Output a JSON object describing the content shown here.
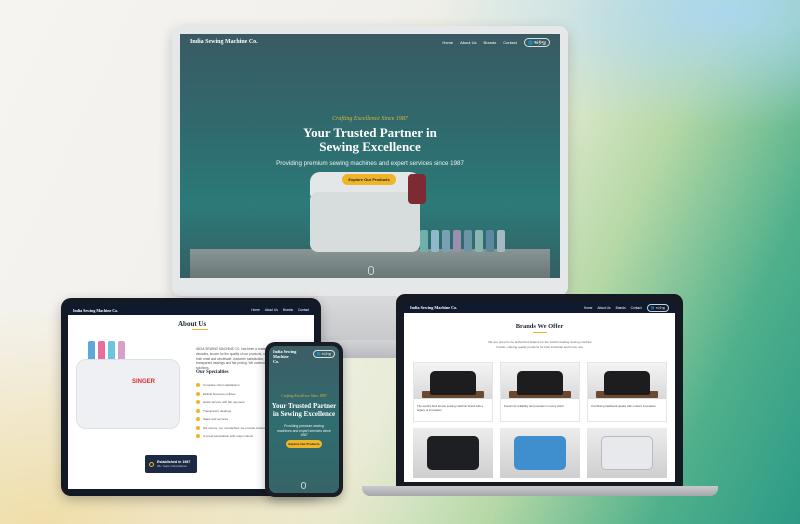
{
  "brand": "India Sewing Machine Co.",
  "nav": {
    "items": [
      "Home",
      "About Us",
      "Brands",
      "Contact"
    ],
    "lang": "🌐 અંગ્રેજી"
  },
  "hero": {
    "tagline": "Crafting Excellence Since 1987",
    "title_line1": "Your Trusted Partner in",
    "title_line2": "Sewing Excellence",
    "subtitle": "Providing premium sewing machines and expert services since 1987",
    "cta": "Explore Our Products"
  },
  "about": {
    "title": "About Us",
    "text": "INDIA SEWING MACHINE CO. has been a trusted name for over four decades, known for the quality of our products, our reputation for service in both retail and wholesale, customer satisfaction, ethical business policies, transparent dealings and fair pricing. We understand, and we provide solutions.",
    "spec_title": "Our Specialties",
    "specialties": [
      "Complete client satisfaction",
      "Ethical business policies",
      "Quick service with fair payment",
      "Transparent dealings",
      "Sales and services",
      "We source, our unmatched, we provide solutions",
      "A proud association with major clients"
    ],
    "badge_title": "Established in 1987",
    "badge_sub": "36+ Years of Excellence",
    "singer_logo": "SINGER"
  },
  "phone": {
    "brand_line1": "India Sewing Machine",
    "brand_line2": "Co.",
    "lang": "🌐 અંગ્રેજી",
    "tagline": "Crafting Excellence Since 1987",
    "title_line1": "Your Trusted Partner",
    "title_line2": "in Sewing Excellence",
    "subtitle": "Providing premium sewing machines and expert services since 1987",
    "cta": "Explore Our Products"
  },
  "brands": {
    "title": "Brands We Offer",
    "subtitle": "We are proud to be authorized dealers for the world's leading sewing machine brands, offering quality products for both industrial and home use.",
    "cards": [
      {
        "text": "The world's best known sewing machine brand with a legacy of innovation"
      },
      {
        "text": "Known for reliability and precision in every stitch"
      },
      {
        "text": "Combining traditional quality with modern innovation"
      }
    ]
  },
  "colors": {
    "accent": "#f0b429",
    "navy": "#0f1a2e",
    "hero_teal": "#2f6b6e",
    "singer_red": "#d62b2b"
  }
}
